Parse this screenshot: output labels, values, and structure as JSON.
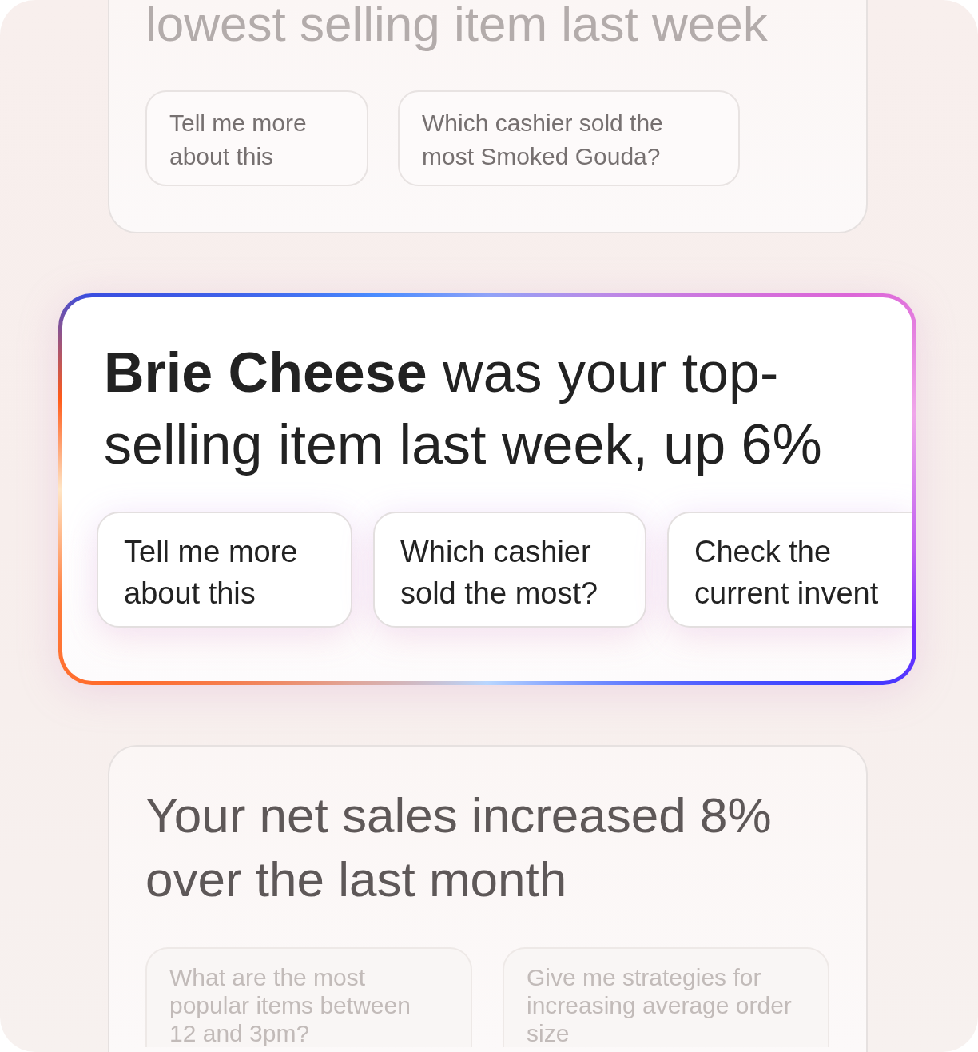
{
  "cards": [
    {
      "title": "lowest selling item last week",
      "selected": false,
      "suggestions": [
        "Tell me more about this",
        "Which cashier sold the most Smoked Gouda?"
      ]
    },
    {
      "title": "**Brie Cheese** was your top-selling item last week, up 6%",
      "selected": true,
      "suggestions": [
        "Tell me more about this",
        "Which cashier sold the most?",
        "Check the current invent"
      ]
    },
    {
      "title": "Your net sales increased 8% over the last month",
      "selected": false,
      "suggestions": [
        "What are the most popular items between 12 and 3pm?",
        "Give me strategies for increasing average order size"
      ]
    }
  ]
}
